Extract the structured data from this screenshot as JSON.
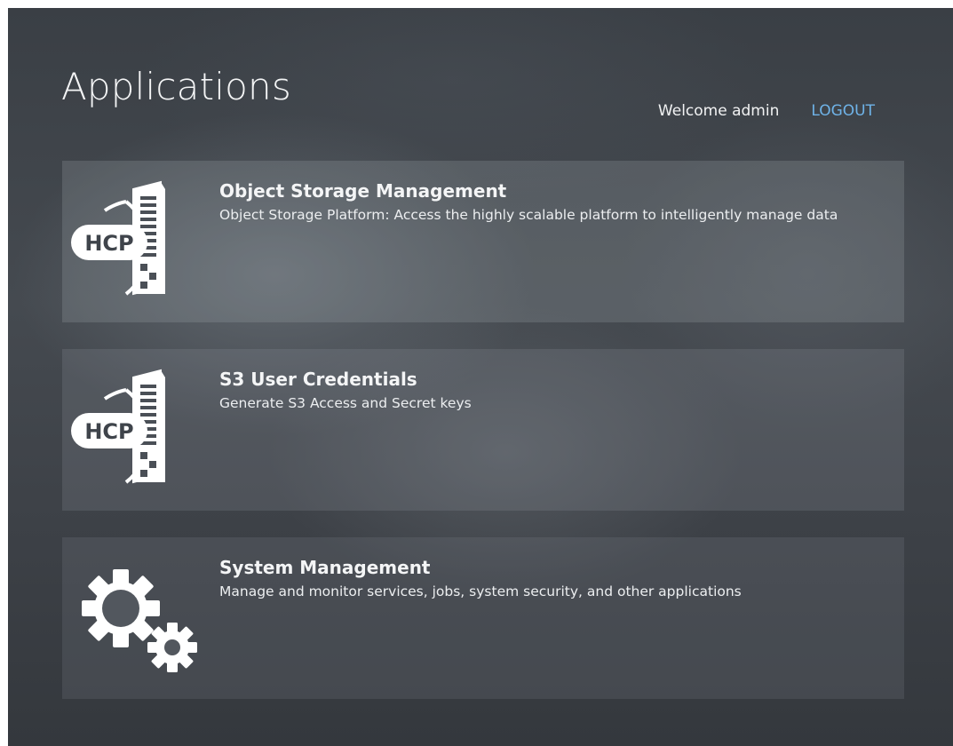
{
  "header": {
    "title": "Applications",
    "welcome_text": "Welcome admin",
    "logout_label": "LOGOUT"
  },
  "colors": {
    "link": "#6fb3e8",
    "text": "#f3f4f5"
  },
  "apps": [
    {
      "icon": "hcp-server-icon",
      "icon_text": "HCP",
      "title": "Object Storage Management",
      "description": "Object Storage Platform: Access the highly scalable platform to intelligently manage data"
    },
    {
      "icon": "hcp-server-icon",
      "icon_text": "HCP",
      "title": "S3 User Credentials",
      "description": "Generate S3 Access and Secret keys"
    },
    {
      "icon": "gears-icon",
      "title": "System Management",
      "description": "Manage and monitor services, jobs, system security, and other applications"
    }
  ]
}
